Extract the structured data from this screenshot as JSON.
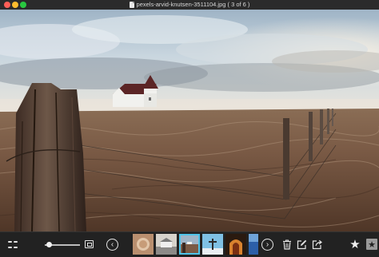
{
  "window": {
    "title": "pexels-arvid-knutsen-3511104.jpg ( 3 of 6 )",
    "buttons": [
      "close",
      "minimize",
      "maximize"
    ]
  },
  "photo": {
    "description_icon": "image-icon"
  },
  "toolbar": {
    "grid_icon": "grid-icon",
    "zoom_slider_value": 0.05,
    "fit_icon": "fit-to-window-icon",
    "prev_icon": "chevron-left-icon",
    "next_icon": "chevron-right-icon",
    "prev_glyph": "‹",
    "next_glyph": "›",
    "thumbnails_count": 6,
    "current_thumbnail": 3,
    "trash_icon": "trash-icon",
    "edit_icon": "edit-icon",
    "share_icon": "share-icon",
    "star_icon": "star-icon",
    "star_glyph": "★",
    "favorite_icon": "favorite-icon",
    "favorite_glyph": "★"
  }
}
